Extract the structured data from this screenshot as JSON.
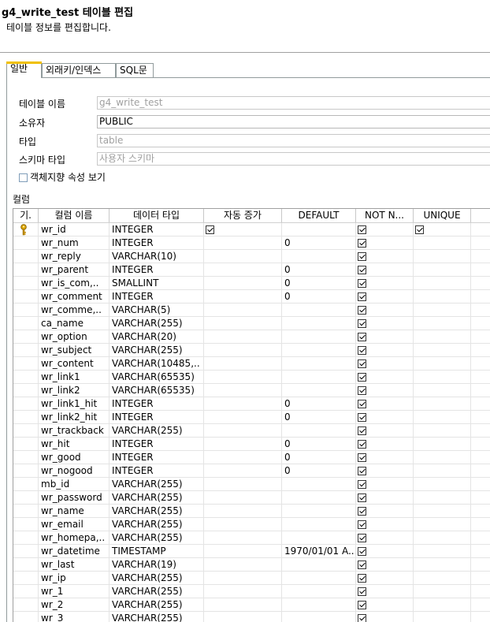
{
  "header": {
    "title": "g4_write_test 테이블 편집",
    "description": "테이블 정보를 편집합니다."
  },
  "tabs": [
    {
      "label": "일반",
      "active": true
    },
    {
      "label": "외래키/인덱스",
      "active": false
    },
    {
      "label": "SQL문",
      "active": false
    }
  ],
  "form": {
    "table_name_label": "테이블 이름",
    "table_name_value": "g4_write_test",
    "owner_label": "소유자",
    "owner_value": "PUBLIC",
    "type_label": "타입",
    "type_value": "table",
    "schema_type_label": "스키마 타입",
    "schema_type_value": "사용자 스키마",
    "object_oriented_label": "객체지향 속성 보기",
    "object_oriented_checked": false
  },
  "columns_section_label": "컬럼",
  "grid": {
    "headers": [
      "기.",
      "컬럼 이름",
      "데이터 타입",
      "자동 증가",
      "DEFAULT",
      "NOT N...",
      "UNIQUE"
    ],
    "rows": [
      {
        "key": true,
        "name": "wr_id",
        "type": "INTEGER",
        "auto": true,
        "default": "",
        "notnull": true,
        "unique": true
      },
      {
        "key": false,
        "name": "wr_num",
        "type": "INTEGER",
        "auto": false,
        "default": "0",
        "notnull": true,
        "unique": false
      },
      {
        "key": false,
        "name": "wr_reply",
        "type": "VARCHAR(10)",
        "auto": false,
        "default": "",
        "notnull": true,
        "unique": false
      },
      {
        "key": false,
        "name": "wr_parent",
        "type": "INTEGER",
        "auto": false,
        "default": "0",
        "notnull": true,
        "unique": false
      },
      {
        "key": false,
        "name": "wr_is_com,..",
        "type": "SMALLINT",
        "auto": false,
        "default": "0",
        "notnull": true,
        "unique": false
      },
      {
        "key": false,
        "name": "wr_comment",
        "type": "INTEGER",
        "auto": false,
        "default": "0",
        "notnull": true,
        "unique": false
      },
      {
        "key": false,
        "name": "wr_comme,..",
        "type": "VARCHAR(5)",
        "auto": false,
        "default": "",
        "notnull": true,
        "unique": false
      },
      {
        "key": false,
        "name": "ca_name",
        "type": "VARCHAR(255)",
        "auto": false,
        "default": "",
        "notnull": true,
        "unique": false
      },
      {
        "key": false,
        "name": "wr_option",
        "type": "VARCHAR(20)",
        "auto": false,
        "default": "",
        "notnull": true,
        "unique": false
      },
      {
        "key": false,
        "name": "wr_subject",
        "type": "VARCHAR(255)",
        "auto": false,
        "default": "",
        "notnull": true,
        "unique": false
      },
      {
        "key": false,
        "name": "wr_content",
        "type": "VARCHAR(10485,..",
        "auto": false,
        "default": "",
        "notnull": true,
        "unique": false
      },
      {
        "key": false,
        "name": "wr_link1",
        "type": "VARCHAR(65535)",
        "auto": false,
        "default": "",
        "notnull": true,
        "unique": false
      },
      {
        "key": false,
        "name": "wr_link2",
        "type": "VARCHAR(65535)",
        "auto": false,
        "default": "",
        "notnull": true,
        "unique": false
      },
      {
        "key": false,
        "name": "wr_link1_hit",
        "type": "INTEGER",
        "auto": false,
        "default": "0",
        "notnull": true,
        "unique": false
      },
      {
        "key": false,
        "name": "wr_link2_hit",
        "type": "INTEGER",
        "auto": false,
        "default": "0",
        "notnull": true,
        "unique": false
      },
      {
        "key": false,
        "name": "wr_trackback",
        "type": "VARCHAR(255)",
        "auto": false,
        "default": "",
        "notnull": true,
        "unique": false
      },
      {
        "key": false,
        "name": "wr_hit",
        "type": "INTEGER",
        "auto": false,
        "default": "0",
        "notnull": true,
        "unique": false
      },
      {
        "key": false,
        "name": "wr_good",
        "type": "INTEGER",
        "auto": false,
        "default": "0",
        "notnull": true,
        "unique": false
      },
      {
        "key": false,
        "name": "wr_nogood",
        "type": "INTEGER",
        "auto": false,
        "default": "0",
        "notnull": true,
        "unique": false
      },
      {
        "key": false,
        "name": "mb_id",
        "type": "VARCHAR(255)",
        "auto": false,
        "default": "",
        "notnull": true,
        "unique": false
      },
      {
        "key": false,
        "name": "wr_password",
        "type": "VARCHAR(255)",
        "auto": false,
        "default": "",
        "notnull": true,
        "unique": false
      },
      {
        "key": false,
        "name": "wr_name",
        "type": "VARCHAR(255)",
        "auto": false,
        "default": "",
        "notnull": true,
        "unique": false
      },
      {
        "key": false,
        "name": "wr_email",
        "type": "VARCHAR(255)",
        "auto": false,
        "default": "",
        "notnull": true,
        "unique": false
      },
      {
        "key": false,
        "name": "wr_homepa,..",
        "type": "VARCHAR(255)",
        "auto": false,
        "default": "",
        "notnull": true,
        "unique": false
      },
      {
        "key": false,
        "name": "wr_datetime",
        "type": "TIMESTAMP",
        "auto": false,
        "default": "1970/01/01 A...",
        "notnull": true,
        "unique": false
      },
      {
        "key": false,
        "name": "wr_last",
        "type": "VARCHAR(19)",
        "auto": false,
        "default": "",
        "notnull": true,
        "unique": false
      },
      {
        "key": false,
        "name": "wr_ip",
        "type": "VARCHAR(255)",
        "auto": false,
        "default": "",
        "notnull": true,
        "unique": false
      },
      {
        "key": false,
        "name": "wr_1",
        "type": "VARCHAR(255)",
        "auto": false,
        "default": "",
        "notnull": true,
        "unique": false
      },
      {
        "key": false,
        "name": "wr_2",
        "type": "VARCHAR(255)",
        "auto": false,
        "default": "",
        "notnull": true,
        "unique": false
      },
      {
        "key": false,
        "name": "wr_3",
        "type": "VARCHAR(255)",
        "auto": false,
        "default": "",
        "notnull": true,
        "unique": false
      }
    ]
  }
}
